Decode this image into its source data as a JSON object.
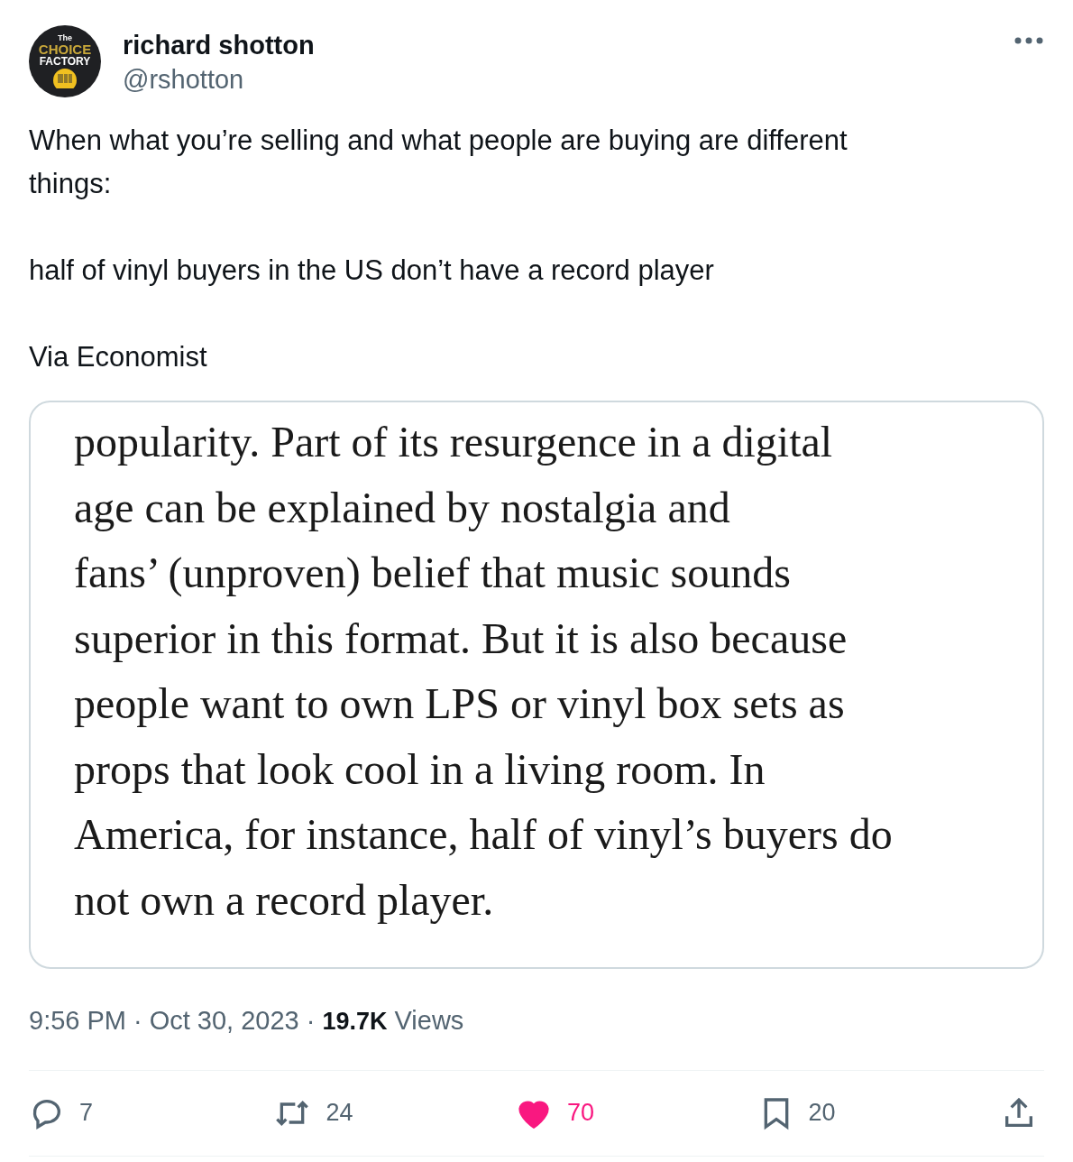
{
  "author": {
    "name": "richard shotton",
    "handle": "@rshotton",
    "avatar_logo": [
      "The",
      "CHOICE",
      "FACTORY"
    ]
  },
  "text_paragraphs": [
    [
      "When what you’re selling and what people are buying are different",
      "things:"
    ],
    [
      "half of vinyl buyers in the US don’t have a record player"
    ],
    [
      "Via Economist"
    ]
  ],
  "media": {
    "kind": "article-excerpt",
    "lines": [
      "popularity. Part of its resurgence in a digital",
      "age can be explained by nostalgia and",
      "fans’ (unproven) belief that music sounds",
      "superior in this format. But it is also because",
      "people want to own LPS or vinyl box sets as",
      "props that look cool in a living room. In",
      "America, for instance, half of vinyl’s buyers do",
      "not own a record player."
    ]
  },
  "meta": {
    "time": "9:56 PM",
    "separator": "·",
    "date": "Oct 30, 2023",
    "separator_2": "·",
    "views_count": "19.7K",
    "views_label": "Views"
  },
  "actions": [
    {
      "kind": "reply",
      "count": "7"
    },
    {
      "kind": "repost",
      "count": "24"
    },
    {
      "kind": "like",
      "count": "70",
      "selected": true
    },
    {
      "kind": "bookmark",
      "count": "20"
    },
    {
      "kind": "share"
    }
  ]
}
